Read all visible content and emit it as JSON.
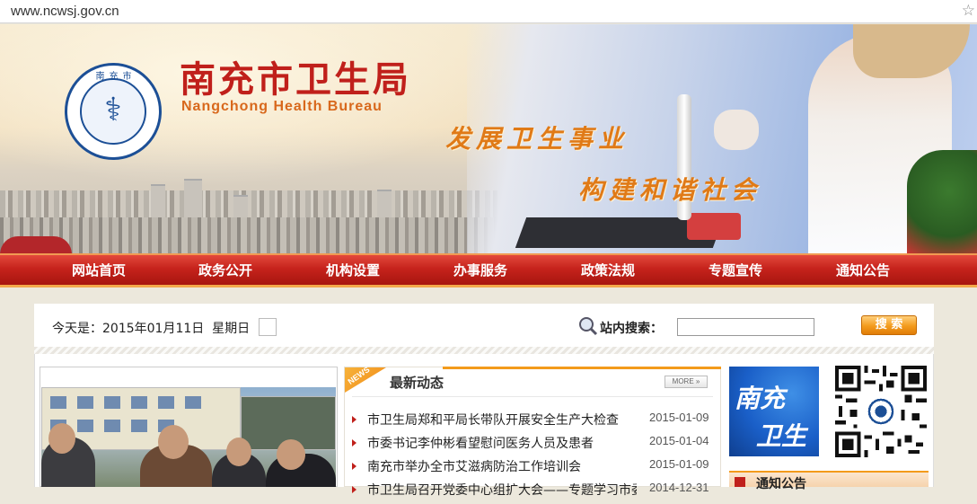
{
  "browser": {
    "url": "www.ncwsj.gov.cn"
  },
  "header": {
    "title_cn": "南充市卫生局",
    "title_en": "Nangchong Health Bureau",
    "logo_ring": "南充市卫生局",
    "slogan_1": "发展卫生事业",
    "slogan_2": "构建和谐社会"
  },
  "nav": {
    "items": [
      {
        "label": "网站首页"
      },
      {
        "label": "政务公开"
      },
      {
        "label": "机构设置"
      },
      {
        "label": "办事服务"
      },
      {
        "label": "政策法规"
      },
      {
        "label": "专题宣传"
      },
      {
        "label": "通知公告"
      }
    ]
  },
  "infobar": {
    "date_text": "今天是：2015年01月11日  星期日",
    "search_label": "站内搜索：",
    "search_value": "",
    "search_button": "搜 索"
  },
  "news": {
    "tag": "NEWS",
    "heading": "最新动态",
    "more": "MORE",
    "items": [
      {
        "title": "市卫生局郑和平局长带队开展安全生产大检查",
        "date": "2015-01-09"
      },
      {
        "title": "市委书记李仲彬看望慰问医务人员及患者",
        "date": "2015-01-04"
      },
      {
        "title": "南充市举办全市艾滋病防治工作培训会",
        "date": "2015-01-09"
      },
      {
        "title": "市卫生局召开党委中心组扩大会——专题学习市委",
        "date": "2014-12-31"
      }
    ]
  },
  "sidebar": {
    "card_line1": "南充",
    "card_line2": "卫生",
    "notice_heading": "通知公告"
  },
  "colors": {
    "nav_red": "#c6231c",
    "title_red": "#c0201b",
    "accent_orange": "#f39b1c"
  }
}
